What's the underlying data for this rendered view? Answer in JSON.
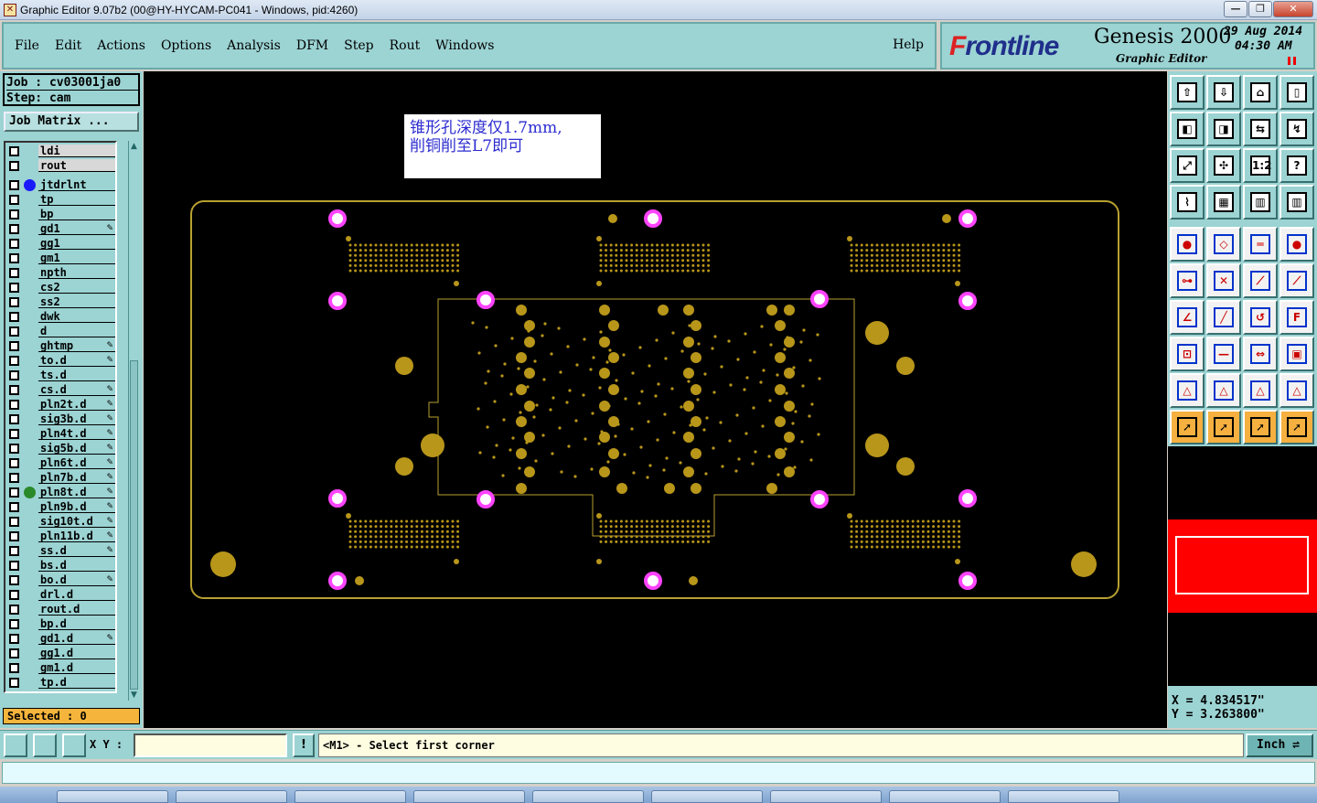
{
  "window": {
    "title": "Graphic Editor 9.07b2 (00@HY-HYCAM-PC041 - Windows, pid:4260)",
    "controls": {
      "minimize": "—",
      "restore": "❐",
      "close": "✕"
    }
  },
  "menu": {
    "items": [
      "File",
      "Edit",
      "Actions",
      "Options",
      "Analysis",
      "DFM",
      "Step",
      "Rout",
      "Windows"
    ],
    "help": "Help"
  },
  "brand": {
    "logo_prefix": "F",
    "logo_rest": "rontline",
    "product": "Genesis 2000",
    "subtitle": "Graphic Editor",
    "date": "29 Aug 2014",
    "time": "04:30 AM"
  },
  "job": {
    "job_line": "Job : cv03001ja0",
    "step_line": "Step: cam",
    "matrix_button": "Job Matrix ..."
  },
  "layers": [
    {
      "name": "ldi",
      "gray": true
    },
    {
      "name": "rout",
      "gray": true
    },
    {
      "name": "jtdrlnt",
      "dot": "#1a1aff"
    },
    {
      "name": "tp"
    },
    {
      "name": "bp"
    },
    {
      "name": "gd1",
      "pen": true
    },
    {
      "name": "gg1"
    },
    {
      "name": "gm1"
    },
    {
      "name": "npth"
    },
    {
      "name": "cs2"
    },
    {
      "name": "ss2"
    },
    {
      "name": "dwk"
    },
    {
      "name": "d"
    },
    {
      "name": "ghtmp",
      "pen": true
    },
    {
      "name": "to.d",
      "pen": true
    },
    {
      "name": "ts.d"
    },
    {
      "name": "cs.d",
      "pen": true
    },
    {
      "name": "pln2t.d",
      "pen": true
    },
    {
      "name": "sig3b.d",
      "pen": true
    },
    {
      "name": "pln4t.d",
      "pen": true
    },
    {
      "name": "sig5b.d",
      "pen": true
    },
    {
      "name": "pln6t.d",
      "pen": true
    },
    {
      "name": "pln7b.d",
      "pen": true
    },
    {
      "name": "pln8t.d",
      "pen": true,
      "dot": "#2a8a2a"
    },
    {
      "name": "pln9b.d",
      "pen": true
    },
    {
      "name": "sig10t.d",
      "pen": true
    },
    {
      "name": "pln11b.d",
      "pen": true
    },
    {
      "name": "ss.d",
      "pen": true
    },
    {
      "name": "bs.d"
    },
    {
      "name": "bo.d",
      "pen": true
    },
    {
      "name": "drl.d"
    },
    {
      "name": "rout.d"
    },
    {
      "name": "bp.d"
    },
    {
      "name": "gd1.d",
      "pen": true
    },
    {
      "name": "gg1.d"
    },
    {
      "name": "gm1.d"
    },
    {
      "name": "tp.d"
    }
  ],
  "selected": "Selected : 0",
  "note": {
    "line1": "锥形孔深度仅1.7mm,",
    "line2": "削铜削至L7即可"
  },
  "coords": {
    "x": "X = 4.834517\"",
    "y": "Y = 3.263800\""
  },
  "statusbar": {
    "xy_label": "X Y :",
    "xy_value": "",
    "excl": "!",
    "prompt": "<M1> - Select first corner",
    "unit": "Inch"
  },
  "colors": {
    "panel": "#9cd3d3",
    "board_outline": "#b8a030",
    "pad": "#b8961a",
    "via_magenta": "#ff44ff",
    "overview_red": "#ff0000",
    "selected_bg": "#f5b53c"
  },
  "toolbar_icons": [
    "zoom-home-icon",
    "zoom-in-icon",
    "home-icon",
    "window-icon",
    "pan-left-icon",
    "pan-right-icon",
    "flip-icon",
    "snap-icon",
    "fit-icon",
    "center-icon",
    "scale-1-2-icon",
    "help-icon",
    "measure-icon",
    "grid-icon",
    "layer-toggle-icon",
    "layer-toggle-2-icon",
    "pad-icon",
    "feature-icon",
    "ruler-icon",
    "circle-icon",
    "connect-icon",
    "cross-icon",
    "line-icon",
    "line-2-icon",
    "angle-icon",
    "slash-icon",
    "arc-icon",
    "text-icon",
    "move-icon",
    "minus-icon",
    "resize-icon",
    "shapes-icon",
    "triangle-icon",
    "triangle-a-icon",
    "triangle-b-icon",
    "triangle-c-icon",
    "pointer-icon",
    "pointer-box-icon",
    "pointer-circle-icon",
    "pointer-multi-icon"
  ]
}
